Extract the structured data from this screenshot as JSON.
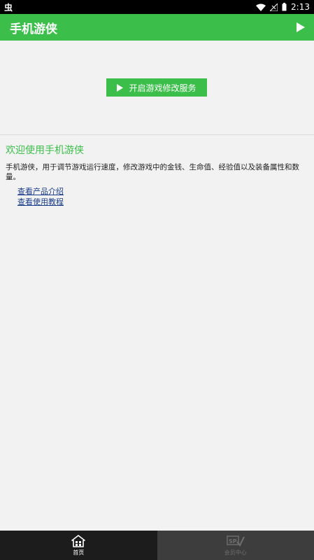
{
  "status_bar": {
    "left_icon": "虫",
    "time": "2:13"
  },
  "app_bar": {
    "title": "手机游侠",
    "action_icon": "play-icon"
  },
  "main": {
    "start_button_label": "开启游戏修改服务",
    "welcome_title": "欢迎使用手机游侠",
    "description": "手机游侠，用于调节游戏运行速度，修改游戏中的金钱、生命值、经验值以及装备属性和数量。",
    "links": [
      "查看产品介绍",
      "查看使用教程"
    ]
  },
  "bottom_nav": {
    "items": [
      {
        "label": "首页",
        "icon": "home-icon",
        "active": true
      },
      {
        "label": "会员中心",
        "icon": "sp-member-icon",
        "active": false
      }
    ]
  },
  "colors": {
    "accent": "#3bbf4a",
    "link": "#1a3c8c",
    "background": "#f2f2f2"
  }
}
